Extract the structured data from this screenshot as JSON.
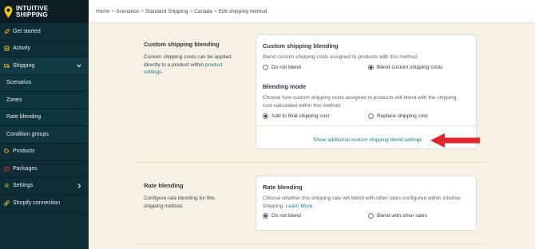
{
  "brand": {
    "line1": "INTUITIVE",
    "line2": "SHIPPING",
    "accent": "#f5c518"
  },
  "sidebar": {
    "items": [
      {
        "label": "Get started",
        "icon": "rocket-icon"
      },
      {
        "label": "Activity",
        "icon": "activity-icon"
      },
      {
        "label": "Shipping",
        "icon": "truck-icon",
        "expanded": true
      },
      {
        "label": "Scenarios"
      },
      {
        "label": "Zones"
      },
      {
        "label": "Rate blending"
      },
      {
        "label": "Condition groups"
      },
      {
        "label": "Products",
        "icon": "tag-icon"
      },
      {
        "label": "Packages",
        "icon": "package-icon"
      },
      {
        "label": "Settings",
        "icon": "gear-icon"
      },
      {
        "label": "Shopify connection",
        "icon": "link-icon"
      }
    ]
  },
  "breadcrumb": [
    "Home",
    "Scenarios",
    "Standard Shipping",
    "Canada",
    "Edit shipping method"
  ],
  "custom_blending": {
    "section_title": "Custom shipping blending",
    "section_desc": "Custom shipping costs can be applied directly to a product within",
    "section_link": "product settings",
    "card_title": "Custom shipping blending",
    "card_desc": "Blend custom shipping costs assigned to products with this method.",
    "options": [
      "Do not blend",
      "Blend custom shipping costs"
    ],
    "selected": 1,
    "mode_title": "Blending mode",
    "mode_desc": "Choose how custom shipping costs assigned to products will blend with the shipping cost calculated within this method.",
    "mode_options": [
      "Add to final shipping cost",
      "Replace shipping cost"
    ],
    "mode_selected": 0,
    "show_more": "Show additional custom shipping blend settings"
  },
  "rate_blending": {
    "section_title": "Rate blending",
    "section_desc": "Configure rate blending for this shipping method.",
    "card_title": "Rate blending",
    "card_desc": "Choose whether this shipping rate will blend with other rates configured within Intuitive Shipping.",
    "learn_more": "Learn More.",
    "options": [
      "Do not blend",
      "Blend with other rates"
    ],
    "selected": 0
  },
  "colors": {
    "sidebar": "#0d2e35",
    "background": "#f7f1e3",
    "link": "#11808f",
    "arrow": "#e3242b"
  }
}
